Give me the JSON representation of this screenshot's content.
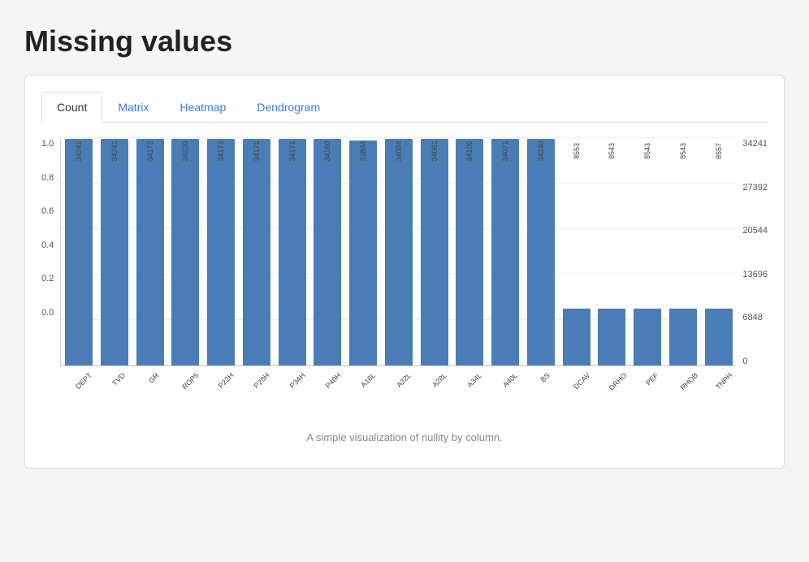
{
  "page": {
    "title": "Missing values"
  },
  "tabs": [
    {
      "label": "Count",
      "active": true
    },
    {
      "label": "Matrix",
      "active": false
    },
    {
      "label": "Heatmap",
      "active": false
    },
    {
      "label": "Dendrogram",
      "active": false
    }
  ],
  "chart": {
    "subtitle": "A simple visualization of nullity by column.",
    "y_axis_left": [
      "1.0",
      "0.8",
      "0.6",
      "0.4",
      "0.2",
      "0.0"
    ],
    "y_axis_right": [
      "34241",
      "27392",
      "20544",
      "13696",
      "6848",
      "0"
    ],
    "bars": [
      {
        "column": "DEPT",
        "value": 34241,
        "ratio": 1.0
      },
      {
        "column": "TVD",
        "value": 34241,
        "ratio": 1.0
      },
      {
        "column": "GR",
        "value": 34172,
        "ratio": 1.0
      },
      {
        "column": "ROP5",
        "value": 34220,
        "ratio": 1.0
      },
      {
        "column": "P22H",
        "value": 34171,
        "ratio": 1.0
      },
      {
        "column": "P28H",
        "value": 34171,
        "ratio": 1.0
      },
      {
        "column": "P34H",
        "value": 34171,
        "ratio": 1.0
      },
      {
        "column": "P40H",
        "value": 34160,
        "ratio": 1.0
      },
      {
        "column": "A16L",
        "value": 33844,
        "ratio": 0.988
      },
      {
        "column": "A22L",
        "value": 34024,
        "ratio": 1.0
      },
      {
        "column": "A28L",
        "value": 34061,
        "ratio": 1.0
      },
      {
        "column": "A34L",
        "value": 34105,
        "ratio": 1.0
      },
      {
        "column": "A40L",
        "value": 34071,
        "ratio": 1.0
      },
      {
        "column": "BS",
        "value": 34240,
        "ratio": 1.0
      },
      {
        "column": "DCAV",
        "value": 8553,
        "ratio": 0.25
      },
      {
        "column": "DRHO",
        "value": 8543,
        "ratio": 0.25
      },
      {
        "column": "PEF",
        "value": 8543,
        "ratio": 0.25
      },
      {
        "column": "RHOB",
        "value": 8543,
        "ratio": 0.25
      },
      {
        "column": "TNPH",
        "value": 8557,
        "ratio": 0.25
      }
    ]
  }
}
